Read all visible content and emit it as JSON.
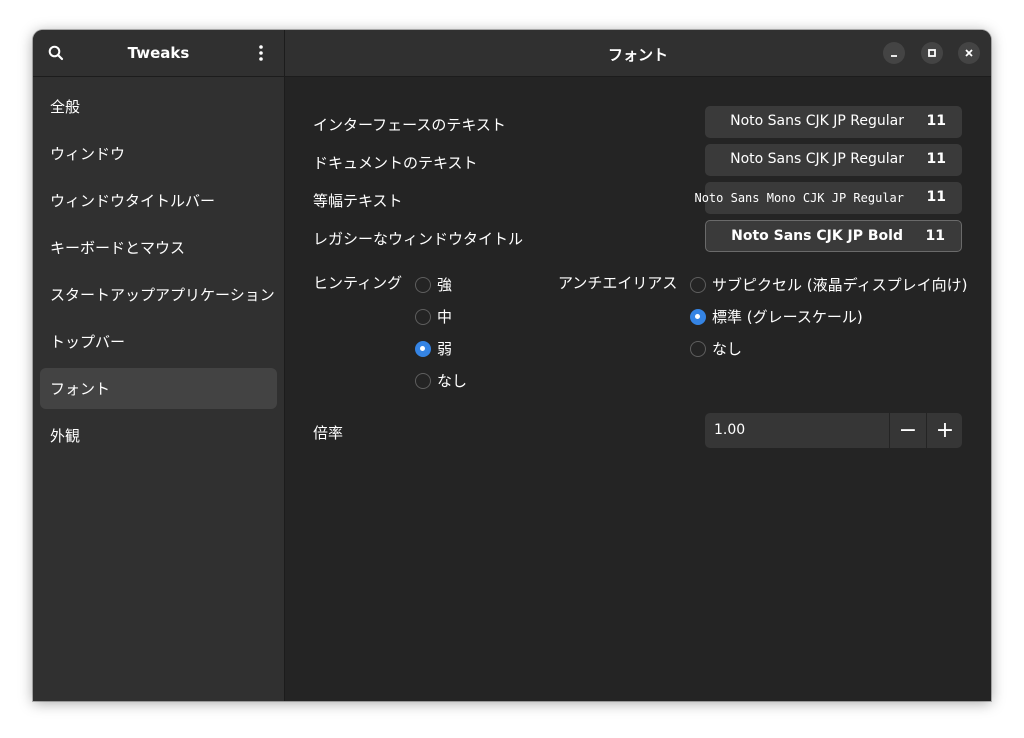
{
  "sidebar": {
    "title": "Tweaks",
    "items": [
      {
        "label": "全般"
      },
      {
        "label": "ウィンドウ"
      },
      {
        "label": "ウィンドウタイトルバー"
      },
      {
        "label": "キーボードとマウス"
      },
      {
        "label": "スタートアップアプリケーション"
      },
      {
        "label": "トップバー"
      },
      {
        "label": "フォント",
        "selected": true
      },
      {
        "label": "外観"
      }
    ]
  },
  "main": {
    "title": "フォント",
    "fonts": [
      {
        "label": "インターフェースのテキスト",
        "font": "Noto Sans CJK JP Regular",
        "size": "11"
      },
      {
        "label": "ドキュメントのテキスト",
        "font": "Noto Sans CJK JP Regular",
        "size": "11"
      },
      {
        "label": "等幅テキスト",
        "font": "Noto Sans Mono CJK JP Regular",
        "size": "11"
      },
      {
        "label": "レガシーなウィンドウタイトル",
        "font": "Noto Sans CJK JP Bold",
        "size": "11"
      }
    ],
    "hinting": {
      "label": "ヒンティング",
      "options": [
        "強",
        "中",
        "弱",
        "なし"
      ],
      "selected": "弱"
    },
    "antialiasing": {
      "label": "アンチエイリアス",
      "options": [
        "サブピクセル (液晶ディスプレイ向け)",
        "標準 (グレースケール)",
        "なし"
      ],
      "selected": "標準 (グレースケール)"
    },
    "scale": {
      "label": "倍率",
      "value": "1.00",
      "minus": "−",
      "plus": "+"
    }
  },
  "icons": {
    "search": "search-icon",
    "menu": "vertical-dots-icon",
    "minimize": "minimize-icon",
    "maximize": "maximize-icon",
    "close": "close-icon"
  },
  "colors": {
    "accent": "#3584e4",
    "window_bg": "#242424",
    "sidebar_bg": "#303030",
    "selected_item": "#434343"
  }
}
